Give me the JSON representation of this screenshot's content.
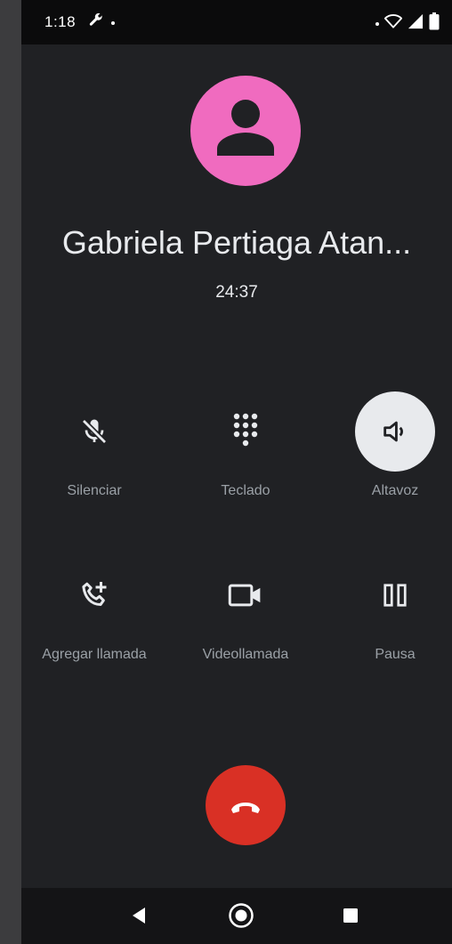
{
  "status_bar": {
    "time": "1:18",
    "left_icons": [
      "wrench-icon",
      "dot-icon"
    ],
    "right_icons": [
      "dot-icon",
      "wifi-icon",
      "signal-icon",
      "battery-icon"
    ]
  },
  "caller": {
    "name": "Gabriela Pertiaga Atan...",
    "duration": "24:37",
    "avatar_color": "#f06bbf"
  },
  "controls": [
    {
      "label": "Silenciar",
      "icon": "mic-off-icon",
      "active": false
    },
    {
      "label": "Teclado",
      "icon": "dialpad-icon",
      "active": false
    },
    {
      "label": "Altavoz",
      "icon": "speaker-icon",
      "active": true
    },
    {
      "label": "Agregar llamada",
      "icon": "add-call-icon",
      "active": false
    },
    {
      "label": "Videollamada",
      "icon": "videocam-icon",
      "active": false
    },
    {
      "label": "Pausa",
      "icon": "pause-icon",
      "active": false
    }
  ],
  "end_call": {
    "icon": "call-end-icon",
    "color": "#d93025"
  },
  "nav_bar": {
    "icons": [
      "back-icon",
      "home-icon",
      "recents-icon"
    ]
  }
}
